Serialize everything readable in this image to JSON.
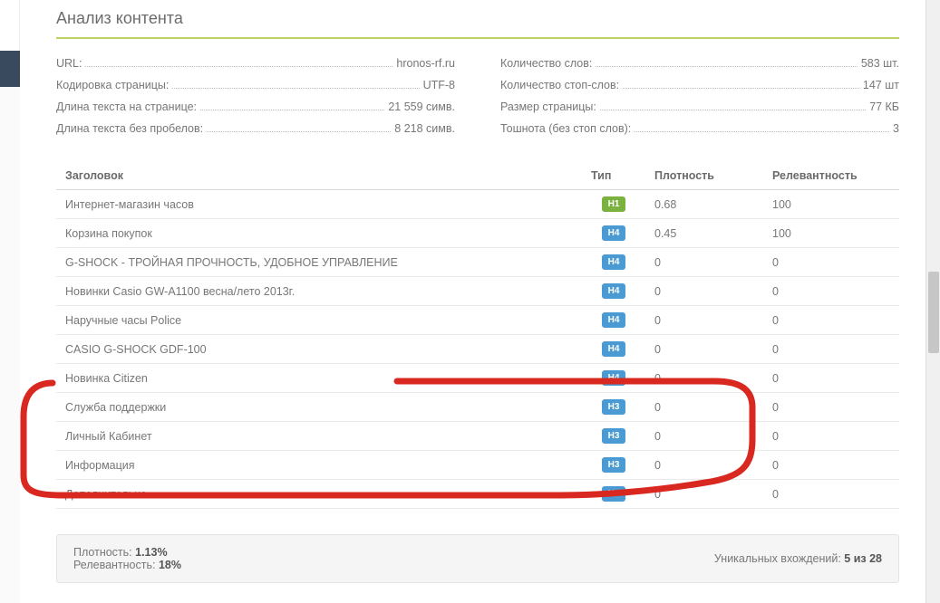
{
  "page_title": "Анализ контента",
  "meta_left": [
    {
      "label": "URL:",
      "value": "hronos-rf.ru"
    },
    {
      "label": "Кодировка страницы:",
      "value": "UTF-8"
    },
    {
      "label": "Длина текста на странице:",
      "value": "21 559 симв."
    },
    {
      "label": "Длина текста без пробелов:",
      "value": "8 218 симв."
    }
  ],
  "meta_right": [
    {
      "label": "Количество слов:",
      "value": "583 шт."
    },
    {
      "label": "Количество стоп-слов:",
      "value": "147 шт"
    },
    {
      "label": "Размер страницы:",
      "value": "77 КБ"
    },
    {
      "label": "Тошнота (без стоп слов):",
      "value": "3"
    }
  ],
  "table": {
    "columns": {
      "title": "Заголовок",
      "type": "Тип",
      "density": "Плотность",
      "relevance": "Релевантность"
    },
    "rows": [
      {
        "title": "Интернет-магазин часов",
        "type": "H1",
        "density": "0.68",
        "relevance": "100"
      },
      {
        "title": "Корзина покупок",
        "type": "H4",
        "density": "0.45",
        "relevance": "100"
      },
      {
        "title": "G-SHOCK - ТРОЙНАЯ ПРОЧНОСТЬ, УДОБНОЕ УПРАВЛЕНИЕ",
        "type": "H4",
        "density": "0",
        "relevance": "0"
      },
      {
        "title": "Новинки Casio GW-A1100 весна/лето 2013г.",
        "type": "H4",
        "density": "0",
        "relevance": "0"
      },
      {
        "title": "Наручные часы Police",
        "type": "H4",
        "density": "0",
        "relevance": "0"
      },
      {
        "title": "CASIO G-SHOCK GDF-100",
        "type": "H4",
        "density": "0",
        "relevance": "0"
      },
      {
        "title": "Новинка Citizen",
        "type": "H4",
        "density": "0",
        "relevance": "0"
      },
      {
        "title": "Служба поддержки",
        "type": "H3",
        "density": "0",
        "relevance": "0"
      },
      {
        "title": "Личный Кабинет",
        "type": "H3",
        "density": "0",
        "relevance": "0"
      },
      {
        "title": "Информация",
        "type": "H3",
        "density": "0",
        "relevance": "0"
      },
      {
        "title": "Дополнительно",
        "type": "H3",
        "density": "0",
        "relevance": "0"
      }
    ]
  },
  "summary": {
    "density_label": "Плотность:",
    "density_value": "1.13%",
    "relevance_label": "Релевантность:",
    "relevance_value": "18%",
    "unique_label": "Уникальных вхождений:",
    "unique_value": "5 из 28"
  },
  "annotation_color": "#d92820"
}
